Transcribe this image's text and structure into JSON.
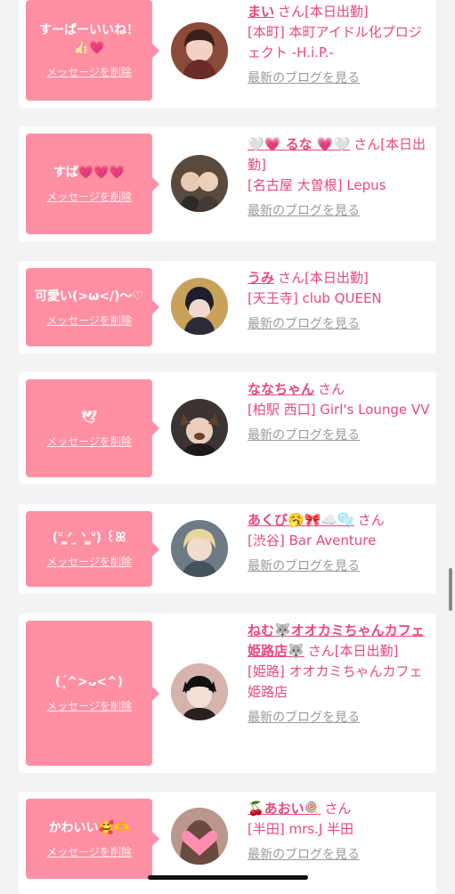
{
  "delete_label": "メッセージを削除",
  "blog_label": "最新のブログを見る",
  "suffix_san": "さん",
  "cards": [
    {
      "message": "すーぱーいいね！👍🏻💗",
      "name": "まい",
      "status": "[本日出勤]",
      "shop": "[本町] 本町アイドル化プロジェクト -H.i.P.-"
    },
    {
      "message": "すば💗💗💗",
      "name": "🤍💗 るな 💗🤍",
      "status": "[本日出勤]",
      "shop": "[名古屋 大曽根] Lepus"
    },
    {
      "message": "可愛い(>ω</)〜♡",
      "name": "うみ",
      "status": "[本日出勤]",
      "shop": "[天王寺] club QUEEN"
    },
    {
      "message": "🕊",
      "name": "ななちゃん",
      "status": "",
      "shop": "[柏駅 西口] Girl's Lounge VV"
    },
    {
      "message": "(ᐡ ̳ᐟ ̫ ᐠ ̳ᐡ) ꒰ꕤ",
      "name": "あくび🥱🎀☁️🫧",
      "status": "",
      "shop": "[渋谷] Bar Aventure"
    },
    {
      "message": "(ˊ̥^>ᴗ<^)",
      "name": "ねむ🐺オオカミちゃんカフェ姫路店🐺",
      "status": "[本日出勤]",
      "shop": "[姫路] オオカミちゃんカフェ姫路店"
    },
    {
      "message": "かわいい🥰🫶",
      "name": "🍒あおい🍭",
      "status": "",
      "shop": "[半田] mrs.J 半田"
    }
  ],
  "colors": {
    "accent": "#e8487e",
    "bubble": "#ff8fa3",
    "muted": "#9a9a9a"
  }
}
